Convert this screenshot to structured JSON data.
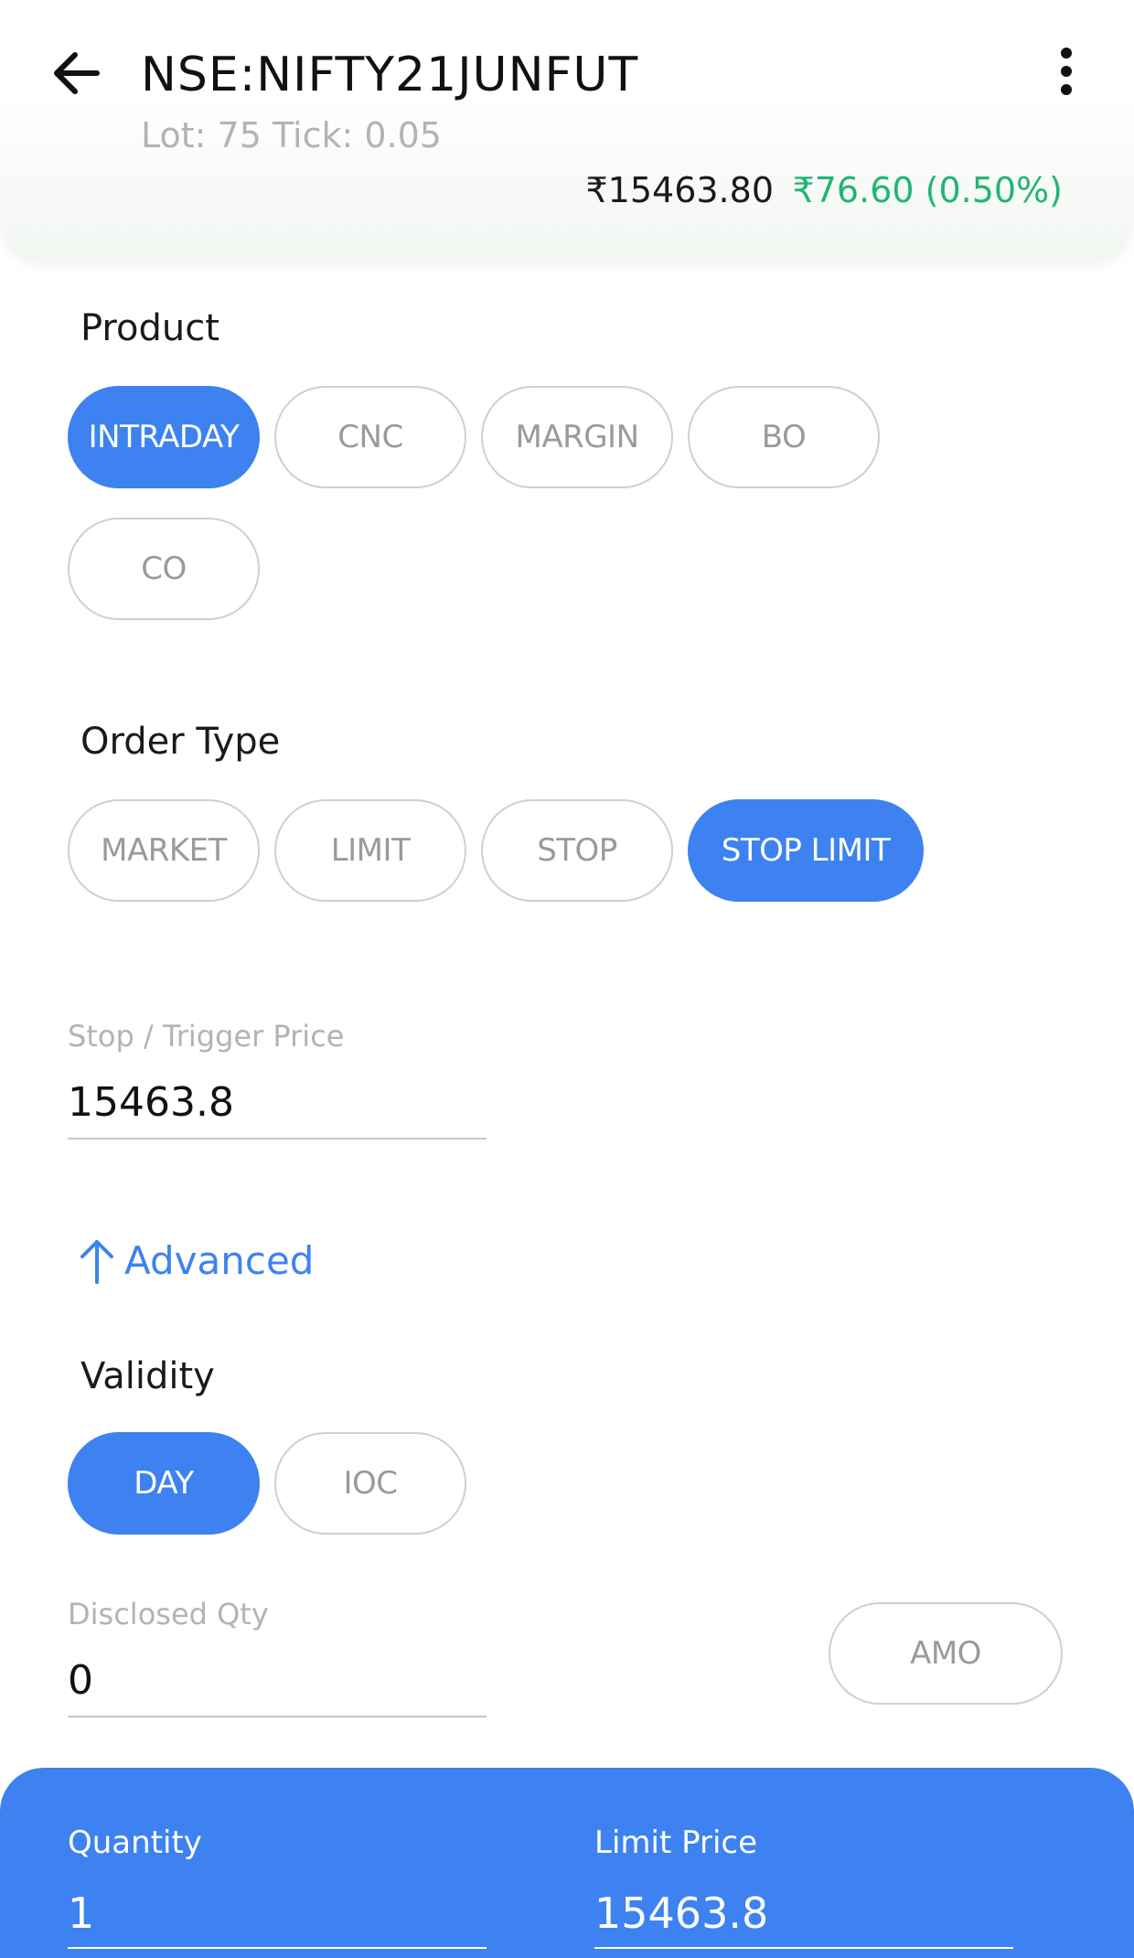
{
  "header": {
    "symbol": "NSE:NIFTY21JUNFUT",
    "lot_tick": "Lot: 75 Tick: 0.05",
    "ltp": "₹15463.80",
    "change": "₹76.60 (0.50%)"
  },
  "product": {
    "title": "Product",
    "options": [
      "INTRADAY",
      "CNC",
      "MARGIN",
      "BO",
      "CO"
    ],
    "selected": "INTRADAY"
  },
  "order_type": {
    "title": "Order Type",
    "options": [
      "MARKET",
      "LIMIT",
      "STOP",
      "STOP LIMIT"
    ],
    "selected": "STOP LIMIT"
  },
  "trigger": {
    "label": "Stop / Trigger Price",
    "value": "15463.8"
  },
  "advanced": {
    "label": "Advanced"
  },
  "validity": {
    "title": "Validity",
    "options": [
      "DAY",
      "IOC"
    ],
    "selected": "DAY"
  },
  "disclosed": {
    "label": "Disclosed Qty",
    "value": "0"
  },
  "amo": {
    "label": "AMO"
  },
  "bottom": {
    "quantity_label": "Quantity",
    "quantity_value": "1",
    "limit_label": "Limit Price",
    "limit_value": "15463.8"
  },
  "colors": {
    "accent": "#3d82f0",
    "positive": "#22b573"
  },
  "icons": {
    "back": "arrow-left-icon",
    "more": "more-vertical-icon",
    "advanced": "arrow-up-icon"
  }
}
